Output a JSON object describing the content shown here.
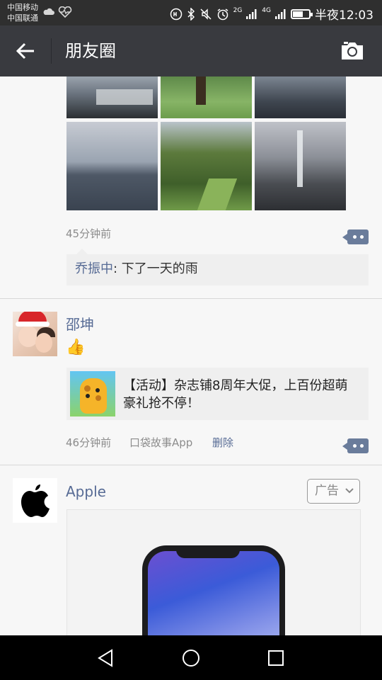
{
  "status_bar": {
    "carrier_1": "中国移动",
    "carrier_2": "中国联通",
    "time": "半夜12:03",
    "signal_2g": "2G",
    "signal_4g": "4G",
    "battery_level": 0.6
  },
  "header": {
    "title": "朋友圈",
    "background_color": "#393a3f"
  },
  "feed": {
    "post_1": {
      "time": "45分钟前",
      "comment": {
        "author": "乔振中",
        "separator": ": ",
        "text": "下了一天的雨"
      }
    },
    "post_2": {
      "author": "邵坤",
      "emoji": "👍",
      "share_text": "【活动】杂志铺8周年大促，上百份超萌豪礼抢不停！",
      "time": "46分钟前",
      "source": "口袋故事App",
      "delete_label": "删除"
    },
    "post_3": {
      "author": "Apple",
      "ad_label": "广告"
    }
  },
  "colors": {
    "link": "#576b95",
    "meta": "#8c8c8c",
    "comment_bg": "#efefef"
  }
}
